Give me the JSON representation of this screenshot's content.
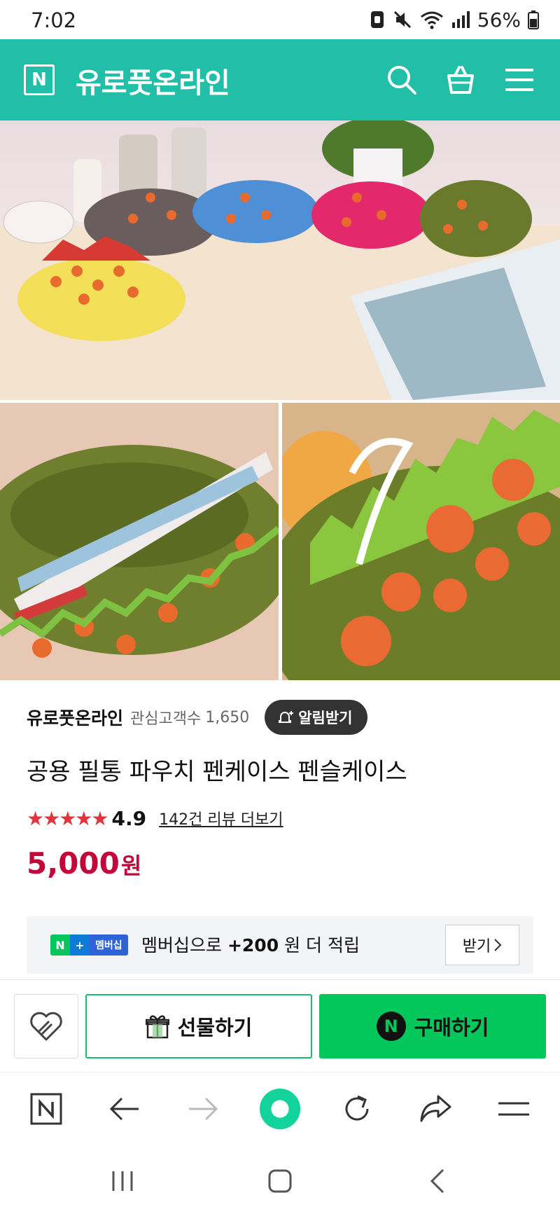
{
  "status_bar": {
    "time": "7:02",
    "battery_pct": "56%"
  },
  "header": {
    "logo_letter": "N",
    "shop_name": "유로풋온라인",
    "icons": [
      "search-icon",
      "cart-icon",
      "menu-icon"
    ],
    "bg_color": "#21bfa8"
  },
  "images": [
    {
      "subject": "five plush dinosaur pencil cases: yellow, gray, blue, pink, green"
    },
    {
      "subject": "green dinosaur pencil case opened with pens inside"
    },
    {
      "subject": "close-up of green dinosaur pencil case spikes and drawstring"
    }
  ],
  "product": {
    "store_name": "유로풋온라인",
    "interest_label": "관심고객수",
    "interest_count": "1,650",
    "alarm_label": "알림받기",
    "title": "공용 필통 파우치 펜케이스 펜슬케이스",
    "stars": "★★★★★",
    "rating": "4.9",
    "review_link": "142건 리뷰 더보기",
    "price": "5,000",
    "currency": "원",
    "price_color": "#c2073b"
  },
  "membership": {
    "badge_n": "N",
    "badge_plus": "+",
    "badge_text": "멤버십",
    "text_prefix": "멤버십으로",
    "points": "+200",
    "text_suffix": "원 더 적립",
    "button_label": "받기"
  },
  "actions": {
    "gift_label": "선물하기",
    "buy_label": "구매하기",
    "buy_color": "#03c75a"
  },
  "browser_bar": {
    "home_letter": "N"
  }
}
